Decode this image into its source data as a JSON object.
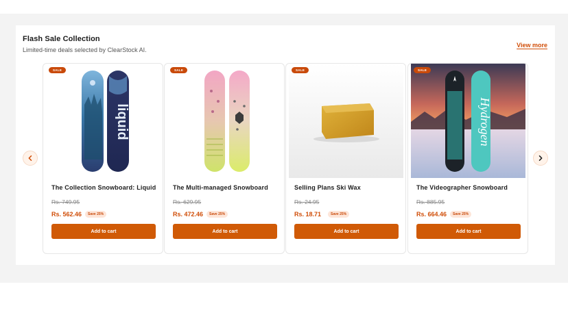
{
  "section": {
    "title": "Flash Sale Collection",
    "subtitle": "Limited-time deals selected by ClearStock AI.",
    "view_more": "View more"
  },
  "nav": {
    "prev_icon": "chevron-left-icon",
    "next_icon": "chevron-right-icon"
  },
  "colors": {
    "accent": "#d05a06",
    "sale_badge": "#c94a0a",
    "price": "#d04d07"
  },
  "products": [
    {
      "badge": "SALE",
      "name": "The Collection Snowboard: Liquid",
      "old_price": "Rs. 749.95",
      "new_price": "Rs. 562.46",
      "save": "Save 25%",
      "button": "Add to cart"
    },
    {
      "badge": "SALE",
      "name": "The Multi-managed Snowboard",
      "old_price": "Rs. 629.95",
      "new_price": "Rs. 472.46",
      "save": "Save 25%",
      "button": "Add to cart"
    },
    {
      "badge": "SALE",
      "name": "Selling Plans Ski Wax",
      "old_price": "Rs. 24.95",
      "new_price": "Rs. 18.71",
      "save": "Save 25%",
      "button": "Add to cart"
    },
    {
      "badge": "SALE",
      "name": "The Videographer Snowboard",
      "old_price": "Rs. 885.95",
      "new_price": "Rs. 664.46",
      "save": "Save 25%",
      "button": "Add to cart"
    }
  ]
}
